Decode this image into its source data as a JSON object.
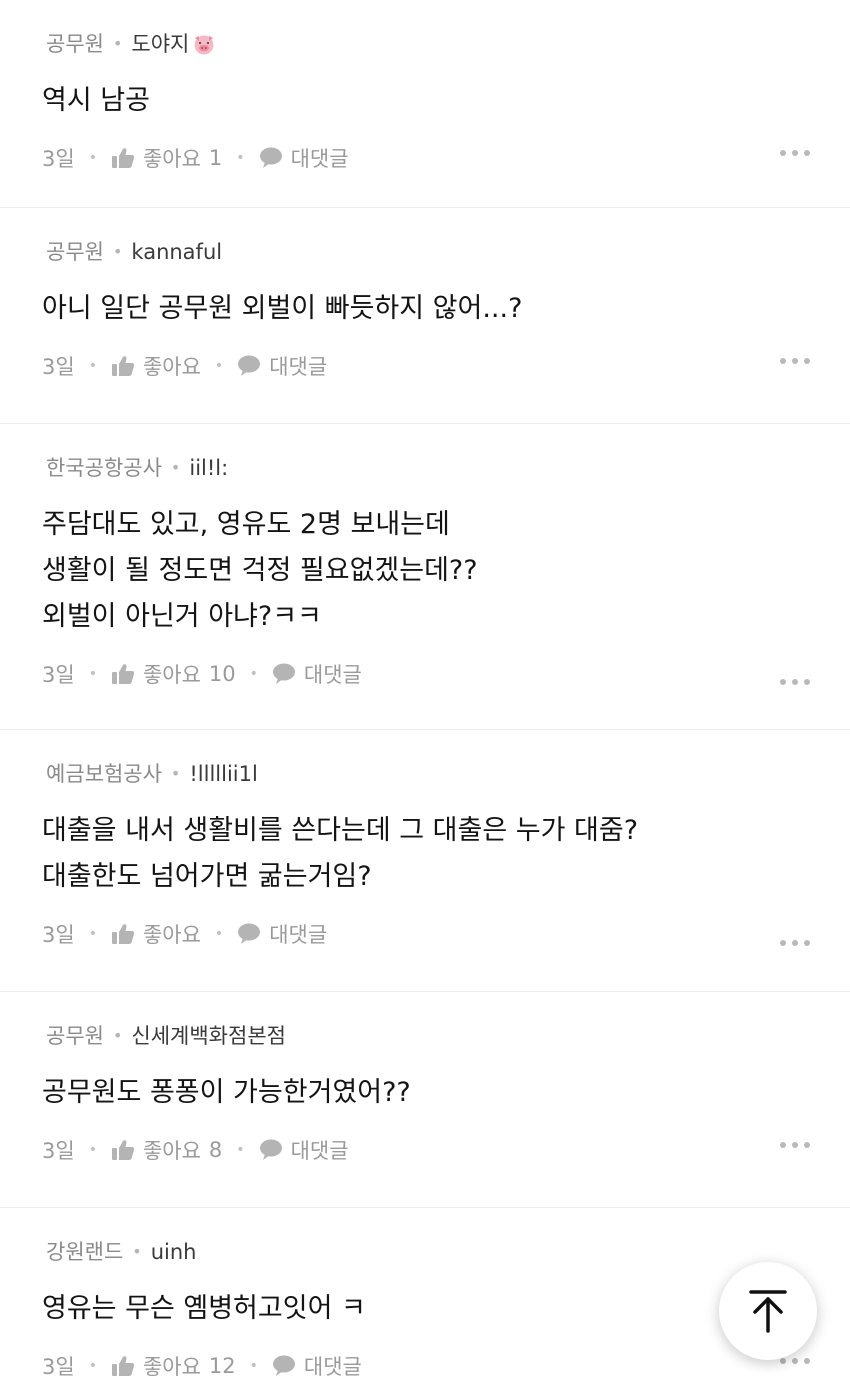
{
  "comments": [
    {
      "company": "공무원",
      "nickname": "도야지",
      "text": "역시 남공",
      "time": "3일",
      "like_label": "좋아요",
      "like_count": "1",
      "reply_label": "대댓글",
      "pig_emoji": true
    },
    {
      "company": "공무원",
      "nickname": "kannaful",
      "text": "아니 일단 공무원 외벌이 빠듯하지 않어...?",
      "time": "3일",
      "like_label": "좋아요",
      "like_count": "",
      "reply_label": "대댓글"
    },
    {
      "company": "한국공항공사",
      "nickname": "iil!l:",
      "text": "주담대도 있고, 영유도 2명 보내는데\n생활이 될 정도면 걱정 필요없겠는데??\n외벌이 아닌거 아냐?ㅋㅋ",
      "time": "3일",
      "like_label": "좋아요",
      "like_count": "10",
      "reply_label": "대댓글"
    },
    {
      "company": "예금보험공사",
      "nickname": "!lllllii1l",
      "text": "대출을 내서 생활비를 쓴다는데 그 대출은 누가 대줌?\n대출한도 넘어가면 굶는거임?",
      "time": "3일",
      "like_label": "좋아요",
      "like_count": "",
      "reply_label": "대댓글"
    },
    {
      "company": "공무원",
      "nickname": "신세계백화점본점",
      "text": "공무원도 퐁퐁이 가능한거였어??",
      "time": "3일",
      "like_label": "좋아요",
      "like_count": "8",
      "reply_label": "대댓글"
    },
    {
      "company": "강원랜드",
      "nickname": "uinh",
      "text": "영유는 무슨 옘병허고잇어 ㅋ",
      "time": "3일",
      "like_label": "좋아요",
      "like_count": "12",
      "reply_label": "대댓글"
    }
  ],
  "icons": {
    "like": "thumbs-up-icon",
    "reply": "speech-bubble-icon",
    "more": "more-dots-icon",
    "scroll_top": "arrow-up-icon"
  },
  "colors": {
    "meta_gray": "#8a8a8a",
    "action_gray": "#9a9a9a",
    "divider": "#ececec"
  }
}
